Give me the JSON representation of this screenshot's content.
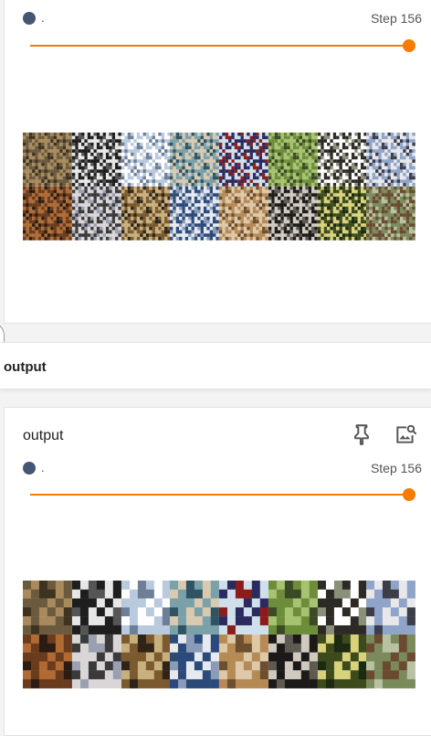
{
  "card1": {
    "run_name": ".",
    "step_label": "Step 156",
    "slider": {
      "position_fraction": 1.0
    }
  },
  "section": {
    "title": "output"
  },
  "card2": {
    "title": "output",
    "run_name": ".",
    "step_label": "Step 156",
    "slider": {
      "position_fraction": 1.0
    },
    "actions": {
      "pin_icon": "pin-icon",
      "image_search_icon": "image-search-icon"
    }
  },
  "colors": {
    "accent": "#f57c00",
    "run_dot": "#455672"
  }
}
